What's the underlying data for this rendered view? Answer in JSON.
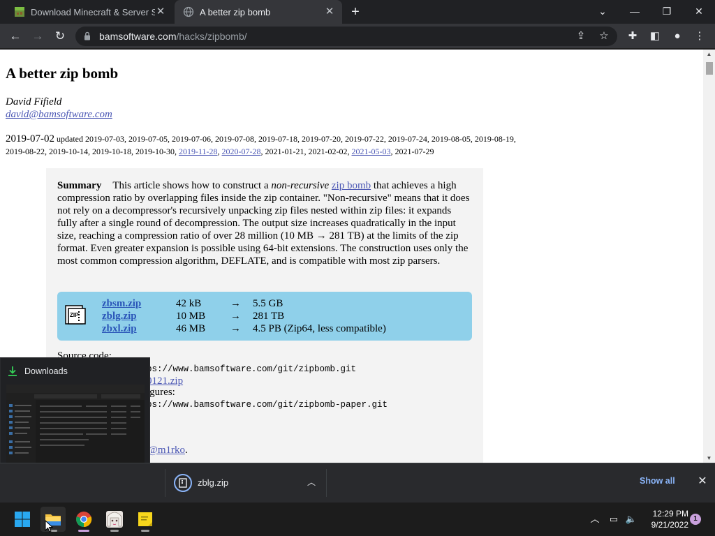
{
  "browser": {
    "tabs": [
      {
        "title": "Download Minecraft & Server So",
        "favicon": "minecraft-block-icon",
        "active": false
      },
      {
        "title": "A better zip bomb",
        "favicon": "globe-icon",
        "active": true
      }
    ],
    "url_host": "bamsoftware.com",
    "url_path": "/hacks/zipbomb/"
  },
  "page": {
    "title": "A better zip bomb",
    "author": "David Fifield",
    "email": "david@bamsoftware.com",
    "date_first": "2019-07-02",
    "date_updated_label": " updated 2019-07-03, 2019-07-05, 2019-07-06, 2019-07-08, 2019-07-18, 2019-07-20, 2019-07-22, 2019-07-24, 2019-08-05, 2019-08-19, 2019-08-22, 2019-10-14, 2019-10-18, 2019-10-30, ",
    "date_link1": "2019-11-28",
    "sep1": ", ",
    "date_link2": "2020-07-28",
    "sep2": ", 2021-01-21, 2021-02-02, ",
    "date_link3": "2021-05-03",
    "sep3": ", 2021-07-29",
    "summary_label": "Summary",
    "summary_p1": "This article shows how to construct a ",
    "summary_em": "non-recursive",
    "summary_p2": " ",
    "summary_link": "zip bomb",
    "summary_p3": " that achieves a high compression ratio by overlapping files inside the zip container. \"Non-recursive\" means that it does not rely on a decompressor's recursively unpacking zip files nested within zip files: it expands fully after a single round of decompression. The output size increases quadratically in the input size, reaching a compression ratio of over 28 million (10 MB → 281 TB) at the limits of the zip format. Even greater expansion is possible using 64-bit extensions. The construction uses only the most common compression algorithm, DEFLATE, and is compatible with most zip parsers.",
    "zip_files": [
      {
        "name": "zbsm.zip",
        "size": "42 kB",
        "arrow": "→",
        "output": "5.5 GB"
      },
      {
        "name": "zblg.zip",
        "size": "10 MB",
        "arrow": "→",
        "output": "281 TB"
      },
      {
        "name": "zbxl.zip",
        "size": "46 MB",
        "arrow": "→",
        "output": "4.5 PB (Zip64, less compatible)"
      }
    ],
    "source_label": "Source code:",
    "source_git": "ps://www.bamsoftware.com/git/zipbomb.git",
    "source_zip": "0121.zip",
    "figures_label": "igures:",
    "figures_git": "ps://www.bamsoftware.com/git/zipbomb-paper.git",
    "twitter": "@m1rko",
    "twitter_tail": "."
  },
  "downloads_card": {
    "title": "Downloads",
    "icon": "download-arrow-icon"
  },
  "download_shelf": {
    "file_name": "zblg.zip",
    "show_all": "Show all"
  },
  "taskbar": {
    "time": "12:29 PM",
    "date": "9/21/2022",
    "notifications": "1"
  },
  "colors": {
    "accent_blue": "#8ab4f8",
    "link": "#4b57b4",
    "zip_box": "#8fd0ea"
  }
}
